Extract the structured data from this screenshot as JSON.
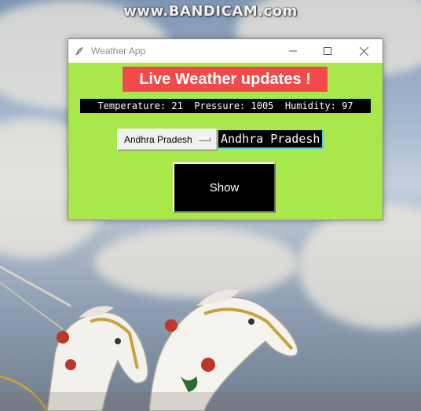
{
  "watermark": {
    "text": "www.BANDICAM.com"
  },
  "window": {
    "title": "Weather App",
    "controls": {
      "minimize_icon": "minimize-icon",
      "maximize_icon": "maximize-icon",
      "close_icon": "close-icon"
    }
  },
  "app": {
    "heading": "Live Weather updates !",
    "stats": "Temperature: 21  Pressure: 1005  Humidity: 97",
    "state_dropdown": {
      "selected": "Andhra Pradesh"
    },
    "selected_label": "Andhra Pradesh",
    "show_button": "Show"
  },
  "colors": {
    "client_bg": "#a8e84a",
    "heading_bg": "#f24a4a",
    "stats_bg": "#000000",
    "button_bg": "#000000"
  }
}
